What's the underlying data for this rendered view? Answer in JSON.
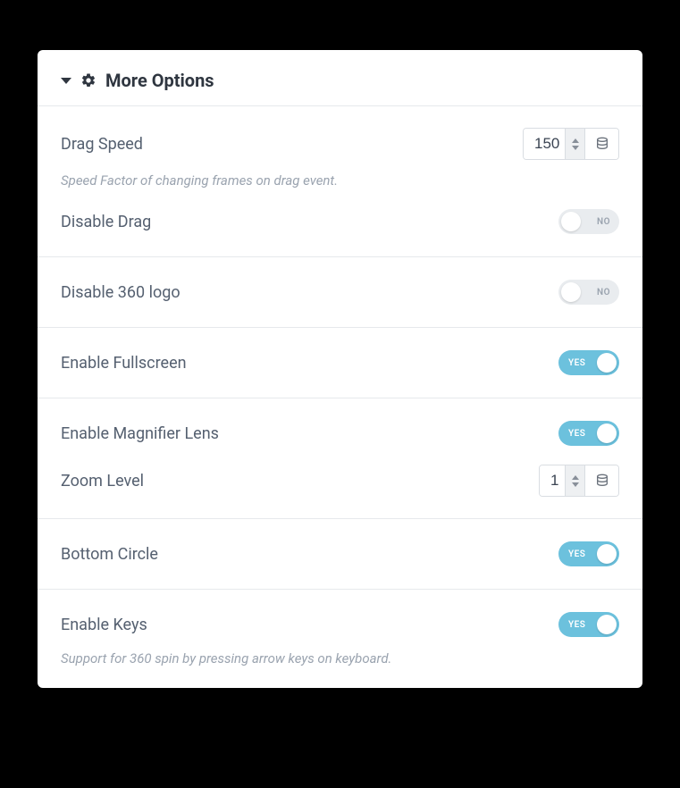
{
  "header": {
    "title": "More Options"
  },
  "toggle_labels": {
    "on": "YES",
    "off": "NO"
  },
  "fields": {
    "drag_speed": {
      "label": "Drag Speed",
      "value": "150",
      "hint": "Speed Factor of changing frames on drag event."
    },
    "disable_drag": {
      "label": "Disable Drag",
      "state": "off"
    },
    "disable_360_logo": {
      "label": "Disable 360 logo",
      "state": "off"
    },
    "enable_fullscreen": {
      "label": "Enable Fullscreen",
      "state": "on"
    },
    "enable_magnifier": {
      "label": "Enable Magnifier Lens",
      "state": "on"
    },
    "zoom_level": {
      "label": "Zoom Level",
      "value": "1"
    },
    "bottom_circle": {
      "label": "Bottom Circle",
      "state": "on"
    },
    "enable_keys": {
      "label": "Enable Keys",
      "state": "on",
      "hint": "Support for 360 spin by pressing arrow keys on keyboard."
    }
  }
}
